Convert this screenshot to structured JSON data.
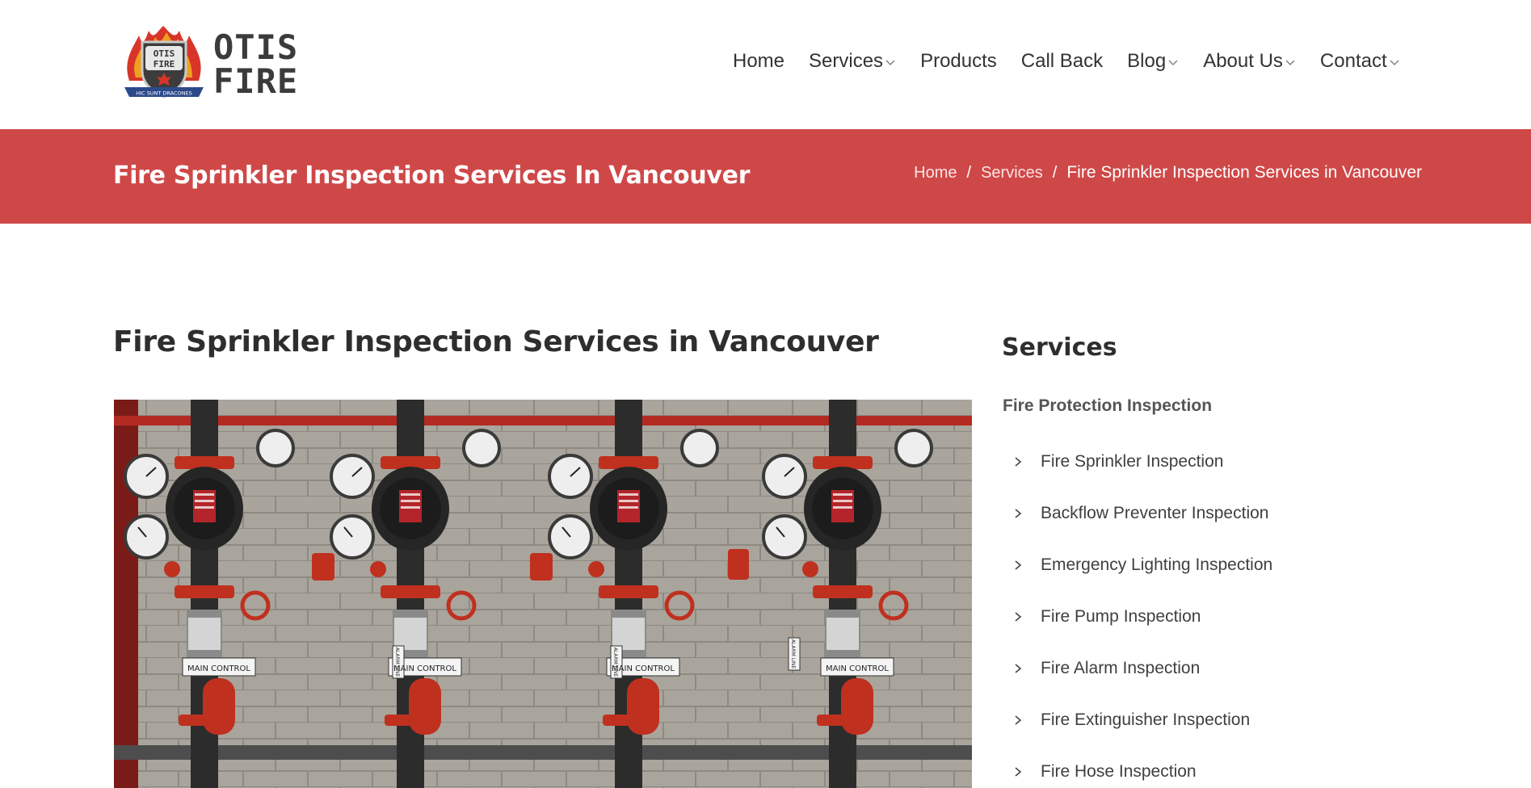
{
  "brand": {
    "logo_line1": "OTIS",
    "logo_line2": "FIRE",
    "badge_line1": "OTIS",
    "badge_line2": "FIRE",
    "motto": "HIC SUNT DRACONES",
    "colors": {
      "red": "#cf4848",
      "dark": "#3b3b3b"
    }
  },
  "nav": {
    "items": [
      {
        "label": "Home",
        "dropdown": false
      },
      {
        "label": "Services",
        "dropdown": true
      },
      {
        "label": "Products",
        "dropdown": false
      },
      {
        "label": "Call Back",
        "dropdown": false
      },
      {
        "label": "Blog",
        "dropdown": true
      },
      {
        "label": "About Us",
        "dropdown": true
      },
      {
        "label": "Contact",
        "dropdown": true
      }
    ]
  },
  "page_header": {
    "title": "Fire Sprinkler Inspection Services In Vancouver",
    "breadcrumb": {
      "home": "Home",
      "separator": "/",
      "services": "Services",
      "current": "Fire Sprinkler Inspection Services in Vancouver"
    }
  },
  "main": {
    "heading": "Fire Sprinkler Inspection Services in Vancouver",
    "image_labels": [
      "MAIN CONTROL",
      "ALARM LINE",
      "MAIN CONTROL",
      "ALARM LINE",
      "MAIN CONTROL",
      "ALARM LINE",
      "MAIN CONTROL"
    ]
  },
  "sidebar": {
    "title": "Services",
    "section": "Fire Protection Inspection",
    "items": [
      "Fire Sprinkler Inspection",
      "Backflow Preventer Inspection",
      "Emergency Lighting Inspection",
      "Fire Pump Inspection",
      "Fire Alarm Inspection",
      "Fire Extinguisher Inspection",
      "Fire Hose Inspection"
    ]
  }
}
